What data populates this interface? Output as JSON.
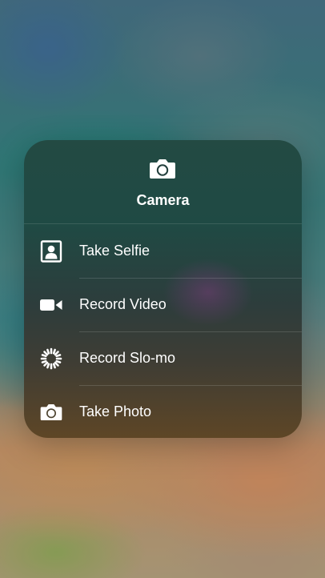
{
  "quick_actions": {
    "title": "Camera",
    "title_icon": "camera-icon",
    "items": [
      {
        "label": "Take Selfie",
        "icon": "selfie-icon"
      },
      {
        "label": "Record Video",
        "icon": "video-camera-icon"
      },
      {
        "label": "Record Slo-mo",
        "icon": "slo-mo-icon"
      },
      {
        "label": "Take Photo",
        "icon": "camera-icon"
      }
    ]
  }
}
